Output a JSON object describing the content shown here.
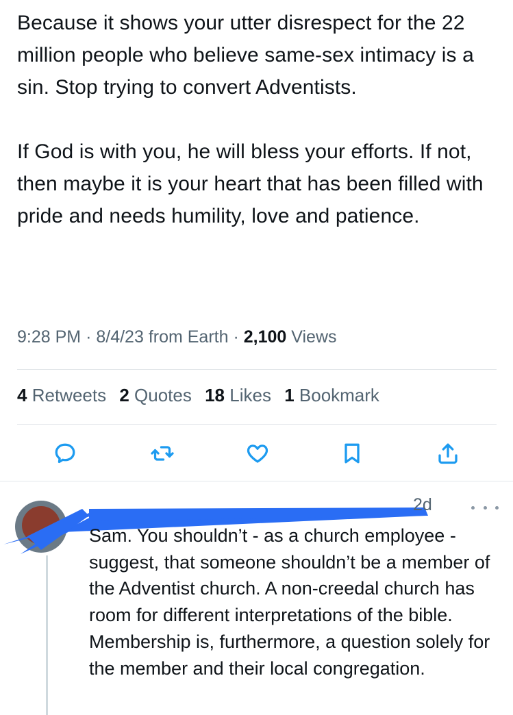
{
  "tweet": {
    "paragraphs": [
      "Because it shows your utter disrespect for the 22 million people who believe same-sex intimacy is a sin. Stop trying to convert Adventists.",
      "If God is with you, he will bless your efforts. If not, then maybe it is your heart that has been filled with pride and needs humility, love and patience."
    ],
    "meta": {
      "time": "9:28 PM",
      "separator": "·",
      "date": "8/4/23",
      "source": "from Earth",
      "views_count": "2,100",
      "views_label": "Views"
    },
    "stats": [
      {
        "num": "4",
        "label": "Retweets"
      },
      {
        "num": "2",
        "label": "Quotes"
      },
      {
        "num": "18",
        "label": "Likes"
      },
      {
        "num": "1",
        "label": "Bookmark"
      }
    ],
    "actions": {
      "accent_color": "#1d9bf0",
      "icons": [
        "reply-icon",
        "retweet-icon",
        "like-icon",
        "bookmark-icon",
        "share-icon"
      ]
    }
  },
  "reply": {
    "time": "2d",
    "more_icon": "more-icon",
    "redaction_color": "#2a6df4",
    "text": "Sam. You shouldn’t - as a church employee - suggest, that someone shouldn’t be a member of the Adventist church. A non-creedal church has room for different interpretations of the bible. Membership is, furthermore, a question solely for the member and their local congregation."
  }
}
